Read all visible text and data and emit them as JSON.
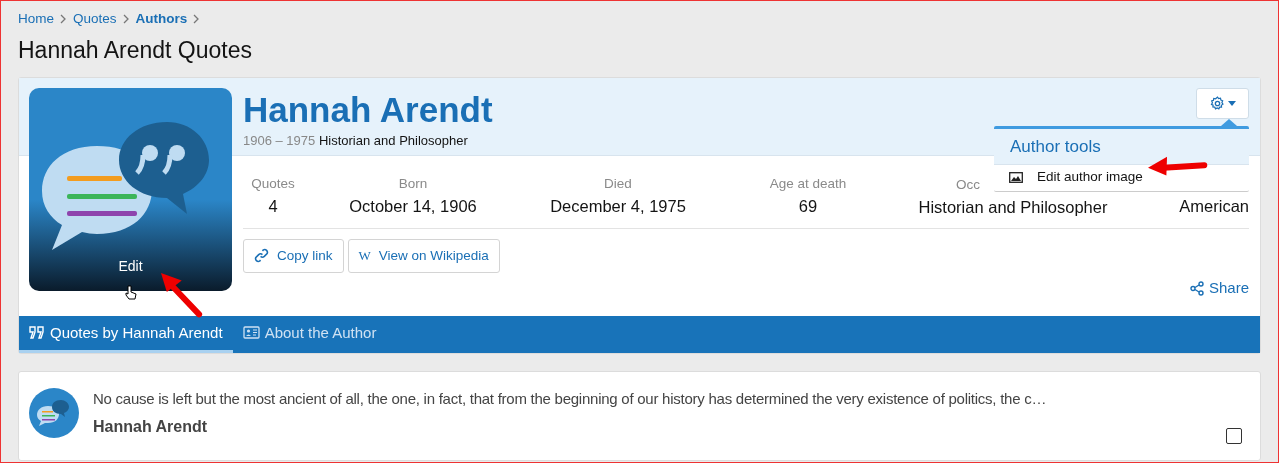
{
  "breadcrumb": [
    {
      "label": "Home",
      "current": false
    },
    {
      "label": "Quotes",
      "current": false
    },
    {
      "label": "Authors",
      "current": true
    }
  ],
  "page_title": "Hannah Arendt Quotes",
  "author": {
    "image_caption": "Edit",
    "name": "Hannah Arendt",
    "years": "1906 – 1975",
    "description": "Historian and Philosopher"
  },
  "stats": [
    {
      "label": "Quotes",
      "value": "4"
    },
    {
      "label": "Born",
      "value": "October 14, 1906"
    },
    {
      "label": "Died",
      "value": "December 4, 1975"
    },
    {
      "label": "Age at death",
      "value": "69"
    },
    {
      "label": "Occ",
      "value": "Historian and Philosopher"
    },
    {
      "value": "American"
    }
  ],
  "buttons": [
    {
      "kind": "link",
      "label": "Copy link"
    },
    {
      "kind": "wiki",
      "label": "View on Wikipedia",
      "icon_text": "W"
    }
  ],
  "share": "Share",
  "author_tools": {
    "title": "Author tools",
    "items": [
      {
        "label": "Edit author image"
      }
    ]
  },
  "tabs": [
    {
      "kind": "quotes",
      "label": "Quotes by Hannah Arendt",
      "selected": true
    },
    {
      "kind": "about",
      "label": "About the Author",
      "selected": false
    }
  ],
  "quotes": [
    {
      "text": "No cause is left but the most ancient of all, the one, in fact, that from the beginning of our history has determined the very existence of politics, the c…",
      "author": "Hannah Arendt",
      "checked": false
    }
  ]
}
